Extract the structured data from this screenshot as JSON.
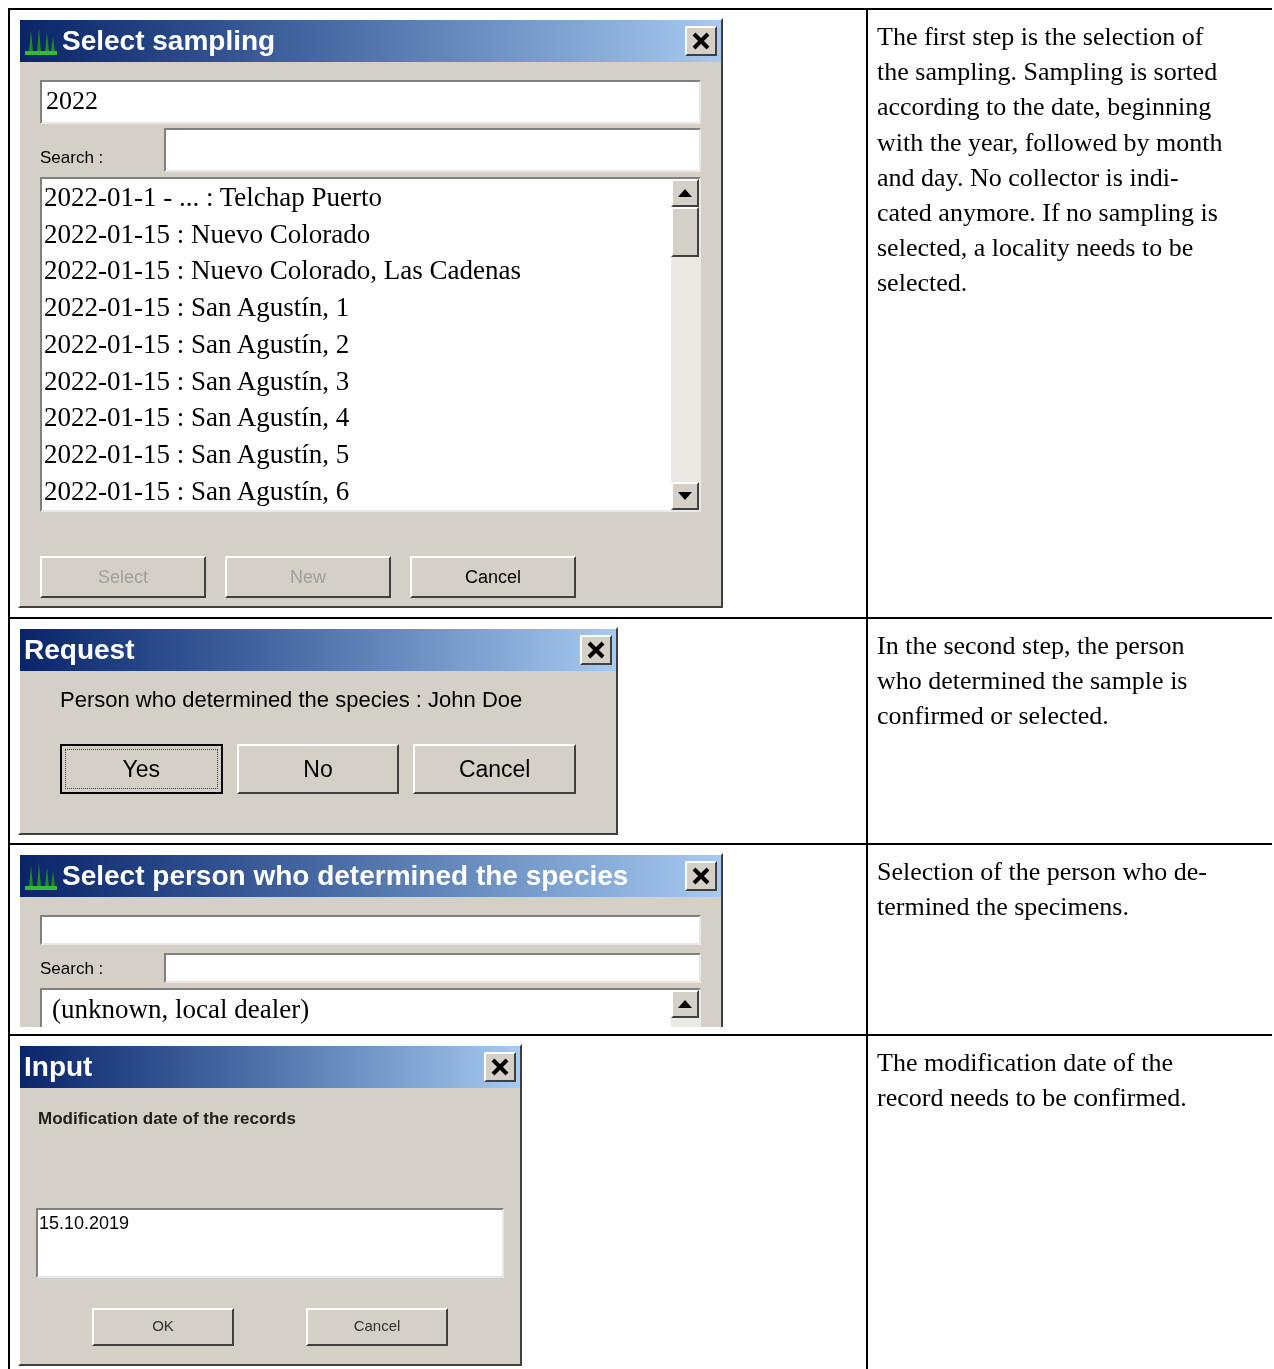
{
  "rows": [
    {
      "dialog": {
        "kind": "select_list",
        "title": "Select sampling",
        "value": "2022",
        "search_label": "Search :",
        "cut": false,
        "items": [
          "2022-01-1 - ... : Telchap Puerto",
          "2022-01-15 : Nuevo Colorado",
          "2022-01-15 : Nuevo Colorado, Las Cadenas",
          "2022-01-15 : San Agustín, 1",
          "2022-01-15 : San Agustín, 2",
          "2022-01-15 : San Agustín, 3",
          "2022-01-15 : San Agustín, 4",
          "2022-01-15 : San Agustín, 5",
          "2022-01-15 : San Agustín, 6"
        ],
        "buttons": [
          {
            "label": "Select",
            "disabled": true
          },
          {
            "label": "New",
            "disabled": true
          },
          {
            "label": "Cancel",
            "disabled": false
          }
        ]
      },
      "description": [
        "The first step is the selection of",
        "the sampling. Sampling is sorted",
        "according to the date, beginning",
        "with the year, followed by month",
        "and day. No collector is indi-",
        "cated anymore. If no sampling is",
        "selected, a locality needs to be",
        "selected."
      ]
    },
    {
      "dialog": {
        "kind": "request",
        "title": "Request",
        "message": "Person who determined the species : John Doe",
        "buttons": [
          {
            "label": "Yes",
            "default": true
          },
          {
            "label": "No",
            "default": false
          },
          {
            "label": "Cancel",
            "default": false
          }
        ]
      },
      "description": [
        "In the second step, the person",
        "who determined the sample is",
        "confirmed or selected."
      ]
    },
    {
      "dialog": {
        "kind": "select_list",
        "title": "Select person who determined the species",
        "search_label": "Search :",
        "cut": true,
        "items": [
          "(unknown, local dealer)"
        ]
      },
      "description": [
        "Selection of the person who de-",
        "termined the specimens."
      ]
    },
    {
      "dialog": {
        "kind": "input",
        "title": "Input",
        "prompt": "Modification date of the records",
        "value": "15.10.2019",
        "buttons": [
          {
            "label": "OK"
          },
          {
            "label": "Cancel"
          }
        ]
      },
      "description": [
        "The modification date of the",
        "record needs to be confirmed."
      ]
    }
  ]
}
